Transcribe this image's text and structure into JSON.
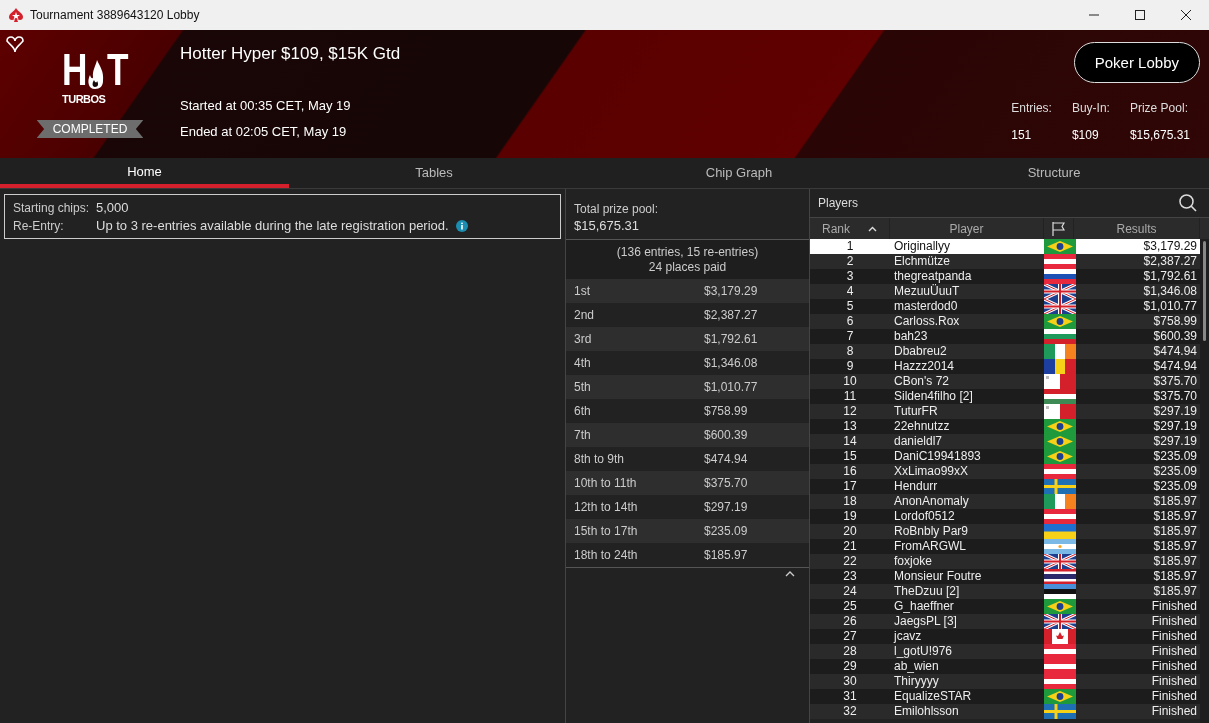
{
  "window": {
    "title": "Tournament 3889643120 Lobby"
  },
  "header": {
    "logo_top": "H",
    "logo_t": "T",
    "logo_bottom": "TURBOS",
    "status": "COMPLETED",
    "title": "Hotter Hyper $109, $15K Gtd",
    "started": "Started at 00:35 CET, May 19",
    "ended": "Ended at 02:05 CET, May 19",
    "lobby_button": "Poker Lobby",
    "stats": [
      {
        "label": "Entries:",
        "value": "151"
      },
      {
        "label": "Buy-In:",
        "value": "$109"
      },
      {
        "label": "Prize Pool:",
        "value": "$15,675.31"
      }
    ]
  },
  "tabs": [
    {
      "label": "Home",
      "selected": true
    },
    {
      "label": "Tables",
      "selected": false
    },
    {
      "label": "Chip Graph",
      "selected": false
    },
    {
      "label": "Structure",
      "selected": false
    }
  ],
  "info": [
    {
      "label": "Starting chips:",
      "value": "5,000",
      "has_info": false
    },
    {
      "label": "Re-Entry:",
      "value": "Up to 3 re-entries available during the late registration period.",
      "has_info": true
    }
  ],
  "prizes": {
    "title": "Total prize pool:",
    "total": "$15,675.31",
    "entries_note": "(136 entries, 15 re-entries)",
    "places_note": "24 places paid",
    "rows": [
      {
        "place": "1st",
        "amount": "$3,179.29"
      },
      {
        "place": "2nd",
        "amount": "$2,387.27"
      },
      {
        "place": "3rd",
        "amount": "$1,792.61"
      },
      {
        "place": "4th",
        "amount": "$1,346.08"
      },
      {
        "place": "5th",
        "amount": "$1,010.77"
      },
      {
        "place": "6th",
        "amount": "$758.99"
      },
      {
        "place": "7th",
        "amount": "$600.39"
      },
      {
        "place": "8th to 9th",
        "amount": "$474.94"
      },
      {
        "place": "10th to 11th",
        "amount": "$375.70"
      },
      {
        "place": "12th to 14th",
        "amount": "$297.19"
      },
      {
        "place": "15th to 17th",
        "amount": "$235.09"
      },
      {
        "place": "18th to 24th",
        "amount": "$185.97"
      }
    ]
  },
  "players": {
    "title": "Players",
    "columns": [
      "Rank",
      "Player",
      "Results"
    ],
    "rows": [
      {
        "rank": "1",
        "name": "Originallyy",
        "kind": "br",
        "result": "$3,179.29",
        "selected": true
      },
      {
        "rank": "2",
        "name": "Elchmütze",
        "kind": "at",
        "result": "$2,387.27",
        "selected": false
      },
      {
        "rank": "3",
        "name": "thegreatpanda",
        "kind": "si",
        "result": "$1,792.61",
        "selected": false
      },
      {
        "rank": "4",
        "name": "MezuuÜuuT",
        "kind": "gb",
        "result": "$1,346.08",
        "selected": false
      },
      {
        "rank": "5",
        "name": "masterdod0",
        "kind": "gb",
        "result": "$1,010.77",
        "selected": false
      },
      {
        "rank": "6",
        "name": "Carloss.Rox",
        "kind": "br",
        "result": "$758.99",
        "selected": false
      },
      {
        "rank": "7",
        "name": "bah23",
        "kind": "bg",
        "result": "$600.39",
        "selected": false
      },
      {
        "rank": "8",
        "name": "Dbabreu2",
        "kind": "ie",
        "result": "$474.94",
        "selected": false
      },
      {
        "rank": "9",
        "name": "Hazzz2014",
        "kind": "ro",
        "result": "$474.94",
        "selected": false
      },
      {
        "rank": "10",
        "name": "CBon's 72",
        "kind": "mt",
        "result": "$375.70",
        "selected": false
      },
      {
        "rank": "11",
        "name": "Silden4filho [2]",
        "kind": "hu",
        "result": "$375.70",
        "selected": false
      },
      {
        "rank": "12",
        "name": "TuturFR",
        "kind": "mt",
        "result": "$297.19",
        "selected": false
      },
      {
        "rank": "13",
        "name": "22ehnutzz",
        "kind": "br",
        "result": "$297.19",
        "selected": false
      },
      {
        "rank": "14",
        "name": "danieldl7",
        "kind": "br",
        "result": "$297.19",
        "selected": false
      },
      {
        "rank": "15",
        "name": "DaniC19941893",
        "kind": "br",
        "result": "$235.09",
        "selected": false
      },
      {
        "rank": "16",
        "name": "XxLimao99xX",
        "kind": "at",
        "result": "$235.09",
        "selected": false
      },
      {
        "rank": "17",
        "name": "Hendurr",
        "kind": "se",
        "result": "$235.09",
        "selected": false
      },
      {
        "rank": "18",
        "name": "AnonAnomaly",
        "kind": "ie",
        "result": "$185.97",
        "selected": false
      },
      {
        "rank": "19",
        "name": "Lordof0512",
        "kind": "at",
        "result": "$185.97",
        "selected": false
      },
      {
        "rank": "20",
        "name": "RoBnbly Par9",
        "kind": "ua",
        "result": "$185.97",
        "selected": false
      },
      {
        "rank": "21",
        "name": "FromARGWL",
        "kind": "ar",
        "result": "$185.97",
        "selected": false
      },
      {
        "rank": "22",
        "name": "foxjoke",
        "kind": "gb",
        "result": "$185.97",
        "selected": false
      },
      {
        "rank": "23",
        "name": "Monsieur Foutre",
        "kind": "th",
        "result": "$185.97",
        "selected": false
      },
      {
        "rank": "24",
        "name": "TheDzuu [2]",
        "kind": "ee",
        "result": "$185.97",
        "selected": false
      },
      {
        "rank": "25",
        "name": "G_haeffner",
        "kind": "br",
        "result": "Finished",
        "selected": false
      },
      {
        "rank": "26",
        "name": "JaegsPL [3]",
        "kind": "gb",
        "result": "Finished",
        "selected": false
      },
      {
        "rank": "27",
        "name": "jcavz",
        "kind": "ca",
        "result": "Finished",
        "selected": false
      },
      {
        "rank": "28",
        "name": "l_gotU!976",
        "kind": "at",
        "result": "Finished",
        "selected": false
      },
      {
        "rank": "29",
        "name": "ab_wien",
        "kind": "at",
        "result": "Finished",
        "selected": false
      },
      {
        "rank": "30",
        "name": "Thiryyyy",
        "kind": "at",
        "result": "Finished",
        "selected": false
      },
      {
        "rank": "31",
        "name": "EqualizeSTAR",
        "kind": "br",
        "result": "Finished",
        "selected": false
      },
      {
        "rank": "32",
        "name": "Emilohlsson",
        "kind": "se",
        "result": "Finished",
        "selected": false
      }
    ]
  }
}
